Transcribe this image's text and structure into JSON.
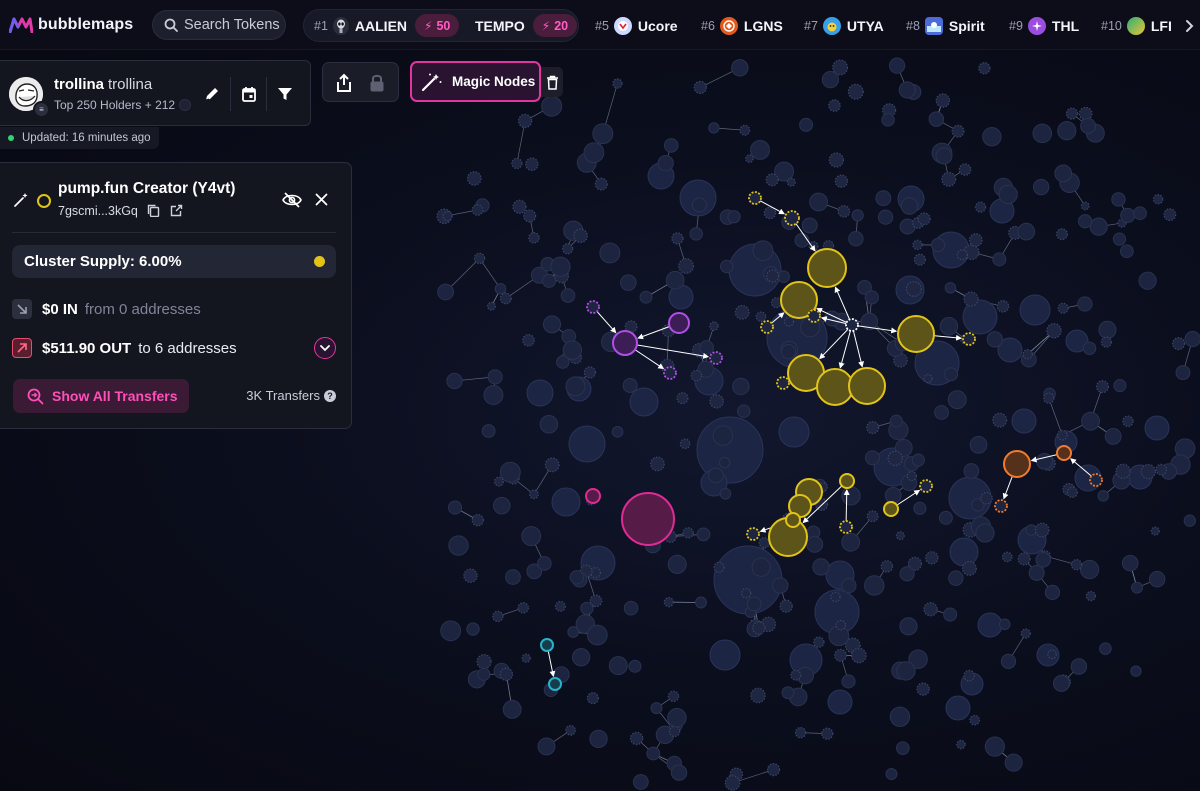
{
  "app": {
    "name": "bubblemaps",
    "search_placeholder": "Search Tokens"
  },
  "trending": [
    {
      "rank": "#1",
      "name": "AALIEN",
      "boost": "50",
      "icon": "alien-icon",
      "color": "#2a2d3a"
    },
    {
      "rank": "",
      "name": "TEMPO",
      "boost": "20",
      "icon": "",
      "color": ""
    },
    {
      "rank": "#5",
      "name": "Ucore",
      "icon": "ucore-icon",
      "color": "#cfd9ff"
    },
    {
      "rank": "#6",
      "name": "LGNS",
      "icon": "lgns-icon",
      "color": "#e25a1c"
    },
    {
      "rank": "#7",
      "name": "UTYA",
      "icon": "duck-icon",
      "color": "#37a0e8"
    },
    {
      "rank": "#8",
      "name": "Spirit",
      "icon": "spirit-icon",
      "color": "#4c6bd8"
    },
    {
      "rank": "#9",
      "name": "THL",
      "icon": "thl-icon",
      "color": "#9b4de0"
    },
    {
      "rank": "#10",
      "name": "LFI",
      "icon": "lfi-icon",
      "color": "#27b07a"
    }
  ],
  "token": {
    "name": "trollina",
    "symbol": "trollina",
    "holders_label": "Top 250 Holders + 212",
    "updated": "Updated: 16 minutes ago"
  },
  "toolbar": {
    "magic_label": "Magic Nodes"
  },
  "wallet": {
    "title": "pump.fun Creator (Y4vt)",
    "address": "7gscmi...3kGq",
    "cluster_supply": "Cluster Supply: 6.00%",
    "in_amount": "$0 IN",
    "in_detail": "from 0 addresses",
    "out_amount": "$511.90 OUT",
    "out_detail": "to 6 addresses",
    "show_transfers": "Show All Transfers",
    "transfers_count": "3K Transfers"
  },
  "colors": {
    "accent": "#e3359f",
    "cluster_yellow": "#e1c417",
    "cluster_purple": "#b14ee6",
    "cluster_orange": "#f07b2e",
    "cluster_magenta": "#e02a94",
    "cluster_cyan": "#27b3c9",
    "bubble": "#1d2542"
  }
}
